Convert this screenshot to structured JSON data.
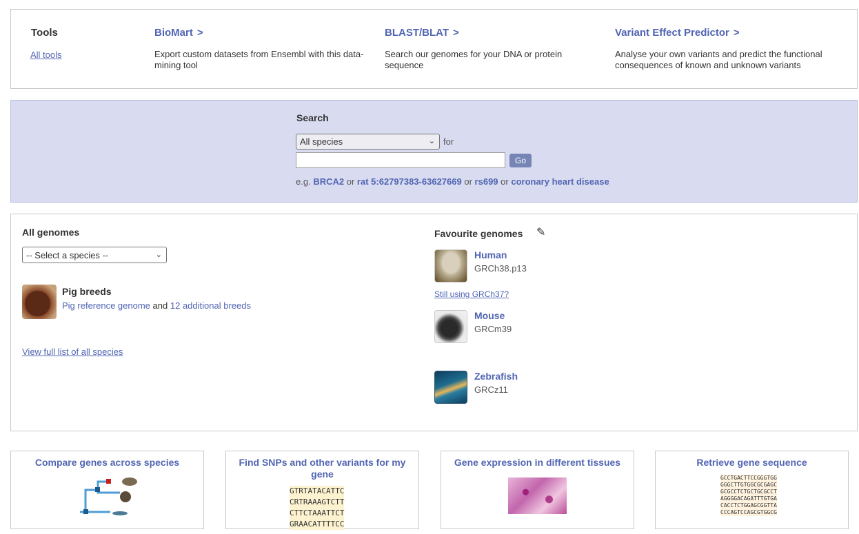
{
  "tools": {
    "title": "Tools",
    "all_tools": "All tools",
    "items": [
      {
        "title": "BioMart",
        "chevron": ">",
        "desc": "Export custom datasets from Ensembl with this data-mining tool"
      },
      {
        "title": "BLAST/BLAT",
        "chevron": ">",
        "desc": "Search our genomes for your DNA or protein sequence"
      },
      {
        "title": "Variant Effect Predictor",
        "chevron": ">",
        "desc": "Analyse your own variants and predict the functional consequences of known and unknown variants"
      }
    ]
  },
  "search": {
    "title": "Search",
    "species_selected": "All species",
    "for_label": "for",
    "input_value": "",
    "go_label": "Go",
    "example_prefix": "e.g.",
    "or": "or",
    "examples": [
      "BRCA2",
      "rat 5:62797383-63627669",
      "rs699",
      "coronary heart disease"
    ]
  },
  "genomes": {
    "all_title": "All genomes",
    "select_species": "-- Select a species --",
    "pig": {
      "title": "Pig breeds",
      "link1": "Pig reference genome",
      "and": "and",
      "link2": "12 additional breeds"
    },
    "view_all": "View full list of all species",
    "fav_title": "Favourite genomes",
    "still_using": "Still using GRCh37?",
    "favourites": [
      {
        "name": "Human",
        "assembly": "GRCh38.p13"
      },
      {
        "name": "Mouse",
        "assembly": "GRCm39"
      },
      {
        "name": "Zebrafish",
        "assembly": "GRCz11"
      }
    ]
  },
  "cards": [
    {
      "title": "Compare genes across species"
    },
    {
      "title": "Find SNPs and other variants for my gene",
      "seq": [
        "GTRTATACATTC",
        "CRTRAAAGTCTT",
        "CTTCTAAATTCT",
        "GRAACATTTTCC"
      ]
    },
    {
      "title": "Gene expression in different tissues"
    },
    {
      "title": "Retrieve gene sequence",
      "seq": [
        "GCCTGACTTCCGGGTGG",
        "GGGCTTGTGGCGCGAGC",
        "GCGCCTCTGCTGCGCCT",
        "AGGGGACAGATTTGTGA",
        "CACCTCTGGAGCGGTTA",
        "CCCAGTCCAGCGTGGCG"
      ]
    }
  ],
  "colors": {
    "link": "#5165b3",
    "search_bg": "#d9dcf0",
    "go_button": "#7785b5"
  }
}
